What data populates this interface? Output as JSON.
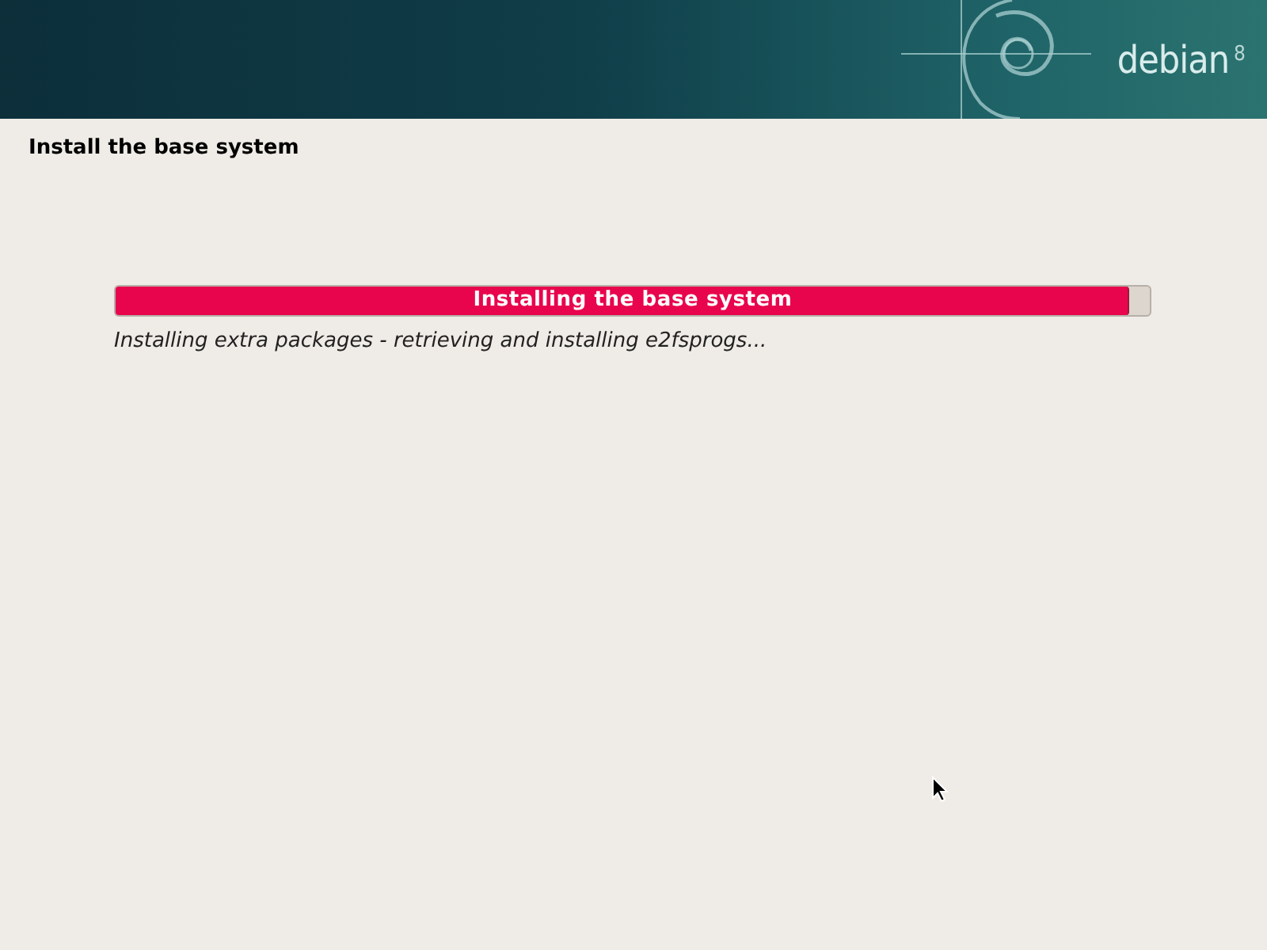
{
  "banner": {
    "logo": "debian$^{8}$"
  },
  "title": "Install the base system",
  "progress": {
    "label": "Installing the base system",
    "level": 0.979,
    "status": "Installing extra packages - retrieving and installing e2fsprogs..."
  }
}
